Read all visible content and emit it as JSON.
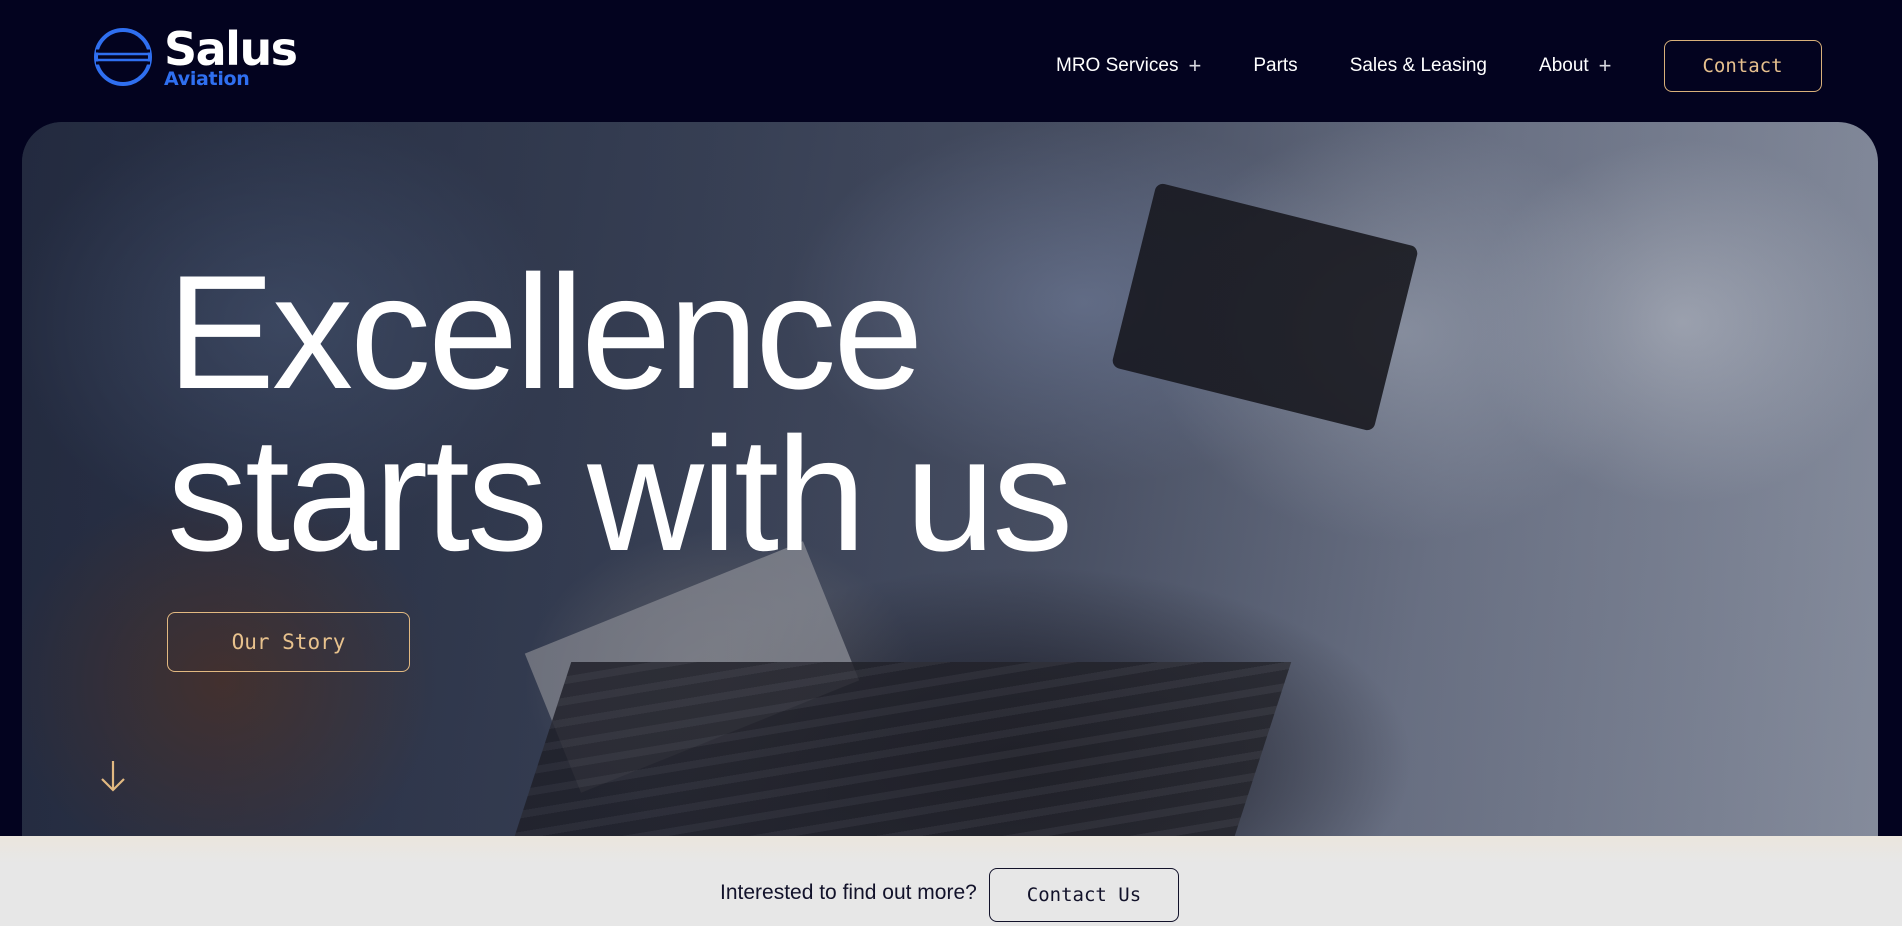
{
  "brand": {
    "name": "Salus",
    "sub": "Aviation",
    "logo_icon": "globe-icon",
    "colors": {
      "primary_blue": "#2f6ff0",
      "navy": "#03031f",
      "accent_gold": "#e2b981"
    }
  },
  "nav": {
    "items": [
      {
        "label": "MRO Services",
        "expandable": true,
        "icon": "plus-icon"
      },
      {
        "label": "Parts",
        "expandable": false
      },
      {
        "label": "Sales & Leasing",
        "expandable": false
      },
      {
        "label": "About",
        "expandable": true,
        "icon": "plus-icon"
      }
    ],
    "contact_label": "Contact"
  },
  "hero": {
    "title_line1": "Excellence",
    "title_line2": "starts with us",
    "cta_label": "Our Story",
    "scroll_icon": "arrow-down-icon"
  },
  "cta_bar": {
    "text": "Interested to find out more?",
    "button_label": "Contact Us"
  }
}
